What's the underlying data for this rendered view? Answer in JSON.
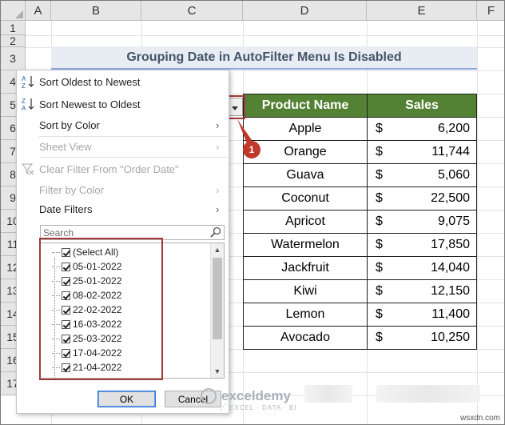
{
  "columns": [
    "A",
    "B",
    "C",
    "D",
    "E",
    "F"
  ],
  "rows": [
    "1",
    "2",
    "3",
    "4",
    "5",
    "6",
    "7",
    "8",
    "9",
    "10",
    "11",
    "12",
    "13",
    "14",
    "15",
    "16",
    "17"
  ],
  "title": "Grouping Date in AutoFilter Menu Is Disabled",
  "table": {
    "header_product": "Product Name",
    "header_sales": "Sales",
    "currency": "$",
    "products": [
      {
        "name": "Apple",
        "sales": "6,200"
      },
      {
        "name": "Orange",
        "sales": "11,744"
      },
      {
        "name": "Guava",
        "sales": "5,060"
      },
      {
        "name": "Coconut",
        "sales": "22,500"
      },
      {
        "name": "Apricot",
        "sales": "9,075"
      },
      {
        "name": "Watermelon",
        "sales": "17,850"
      },
      {
        "name": "Jackfruit",
        "sales": "14,040"
      },
      {
        "name": "Kiwi",
        "sales": "12,150"
      },
      {
        "name": "Lemon",
        "sales": "11,400"
      },
      {
        "name": "Avocado",
        "sales": "10,250"
      }
    ]
  },
  "callout": "1",
  "menu": {
    "sort_oldest": "Sort Oldest to Newest",
    "sort_newest": "Sort Newest to Oldest",
    "sort_by_color": "Sort by Color",
    "sheet_view": "Sheet View",
    "clear_filter": "Clear Filter From \"Order Date\"",
    "filter_by_color": "Filter by Color",
    "date_filters": "Date Filters",
    "search_placeholder": "Search",
    "select_all": "(Select All)",
    "dates": [
      "05-01-2022",
      "25-01-2022",
      "08-02-2022",
      "22-02-2022",
      "16-03-2022",
      "25-03-2022",
      "17-04-2022",
      "21-04-2022"
    ],
    "ok": "OK",
    "cancel": "Cancel"
  },
  "watermark": {
    "name": "exceldemy",
    "sub": "EXCEL · DATA · BI"
  },
  "site": "wsxdn.com",
  "colors": {
    "header_green": "#548235",
    "title_text": "#44546a",
    "highlight_red": "#a33a3a",
    "callout_red": "#c0392b"
  }
}
